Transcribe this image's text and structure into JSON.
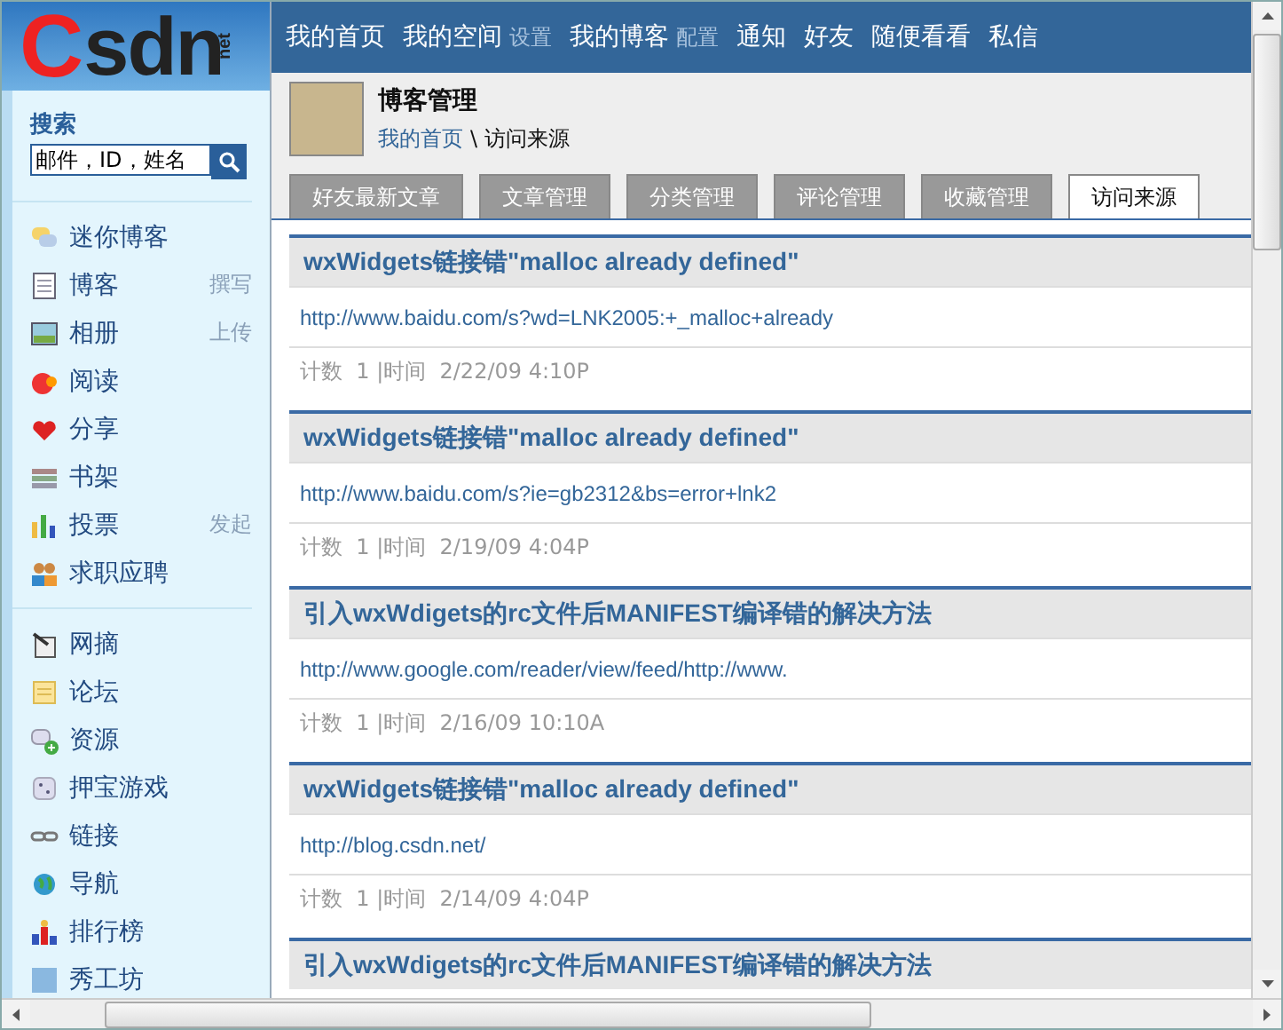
{
  "logo": {
    "initial": "C",
    "rest": "sdn",
    "suffix": "net"
  },
  "nav": [
    {
      "label": "我的首页"
    },
    {
      "label": "我的空间",
      "sub": "设置"
    },
    {
      "label": "我的博客",
      "sub": "配置"
    },
    {
      "label": "通知"
    },
    {
      "label": "好友"
    },
    {
      "label": "随便看看"
    },
    {
      "label": "私信"
    }
  ],
  "search": {
    "label": "搜索",
    "value": "邮件，ID，姓名"
  },
  "sidebar": {
    "groups": [
      [
        {
          "label": "迷你博客"
        },
        {
          "label": "博客",
          "action": "撰写"
        },
        {
          "label": "相册",
          "action": "上传"
        },
        {
          "label": "阅读"
        },
        {
          "label": "分享"
        },
        {
          "label": "书架"
        },
        {
          "label": "投票",
          "action": "发起"
        },
        {
          "label": "求职应聘"
        }
      ],
      [
        {
          "label": "网摘"
        },
        {
          "label": "论坛"
        },
        {
          "label": "资源"
        },
        {
          "label": "押宝游戏"
        },
        {
          "label": "链接"
        },
        {
          "label": "导航"
        },
        {
          "label": "排行榜"
        },
        {
          "label": "秀工坊"
        }
      ]
    ]
  },
  "header": {
    "title": "博客管理",
    "breadcrumb": {
      "link": "我的首页",
      "current": "\\ 访问来源"
    }
  },
  "tabs": [
    {
      "label": "好友最新文章",
      "selected": false
    },
    {
      "label": "文章管理",
      "selected": false
    },
    {
      "label": "分类管理",
      "selected": false
    },
    {
      "label": "评论管理",
      "selected": false
    },
    {
      "label": "收藏管理",
      "selected": false
    },
    {
      "label": "访问来源",
      "selected": true
    }
  ],
  "entries": [
    {
      "title": "wxWidgets链接错\"malloc already defined\"",
      "url": "http://www.baidu.com/s?wd=LNK2005:+_malloc+already",
      "meta": "计数  1 |时间  2/22/09 4:10P"
    },
    {
      "title": "wxWidgets链接错\"malloc already defined\"",
      "url": "http://www.baidu.com/s?ie=gb2312&bs=error+lnk2",
      "meta": "计数  1 |时间  2/19/09 4:04P"
    },
    {
      "title": "引入wxWdigets的rc文件后MANIFEST编译错的解决方法",
      "url": "http://www.google.com/reader/view/feed/http://www.",
      "meta": "计数  1 |时间  2/16/09 10:10A"
    },
    {
      "title": "wxWidgets链接错\"malloc already defined\"",
      "url": "http://blog.csdn.net/",
      "meta": "计数  1 |时间  2/14/09 4:04P"
    },
    {
      "title": "引入wxWdigets的rc文件后MANIFEST编译错的解决方法"
    }
  ]
}
